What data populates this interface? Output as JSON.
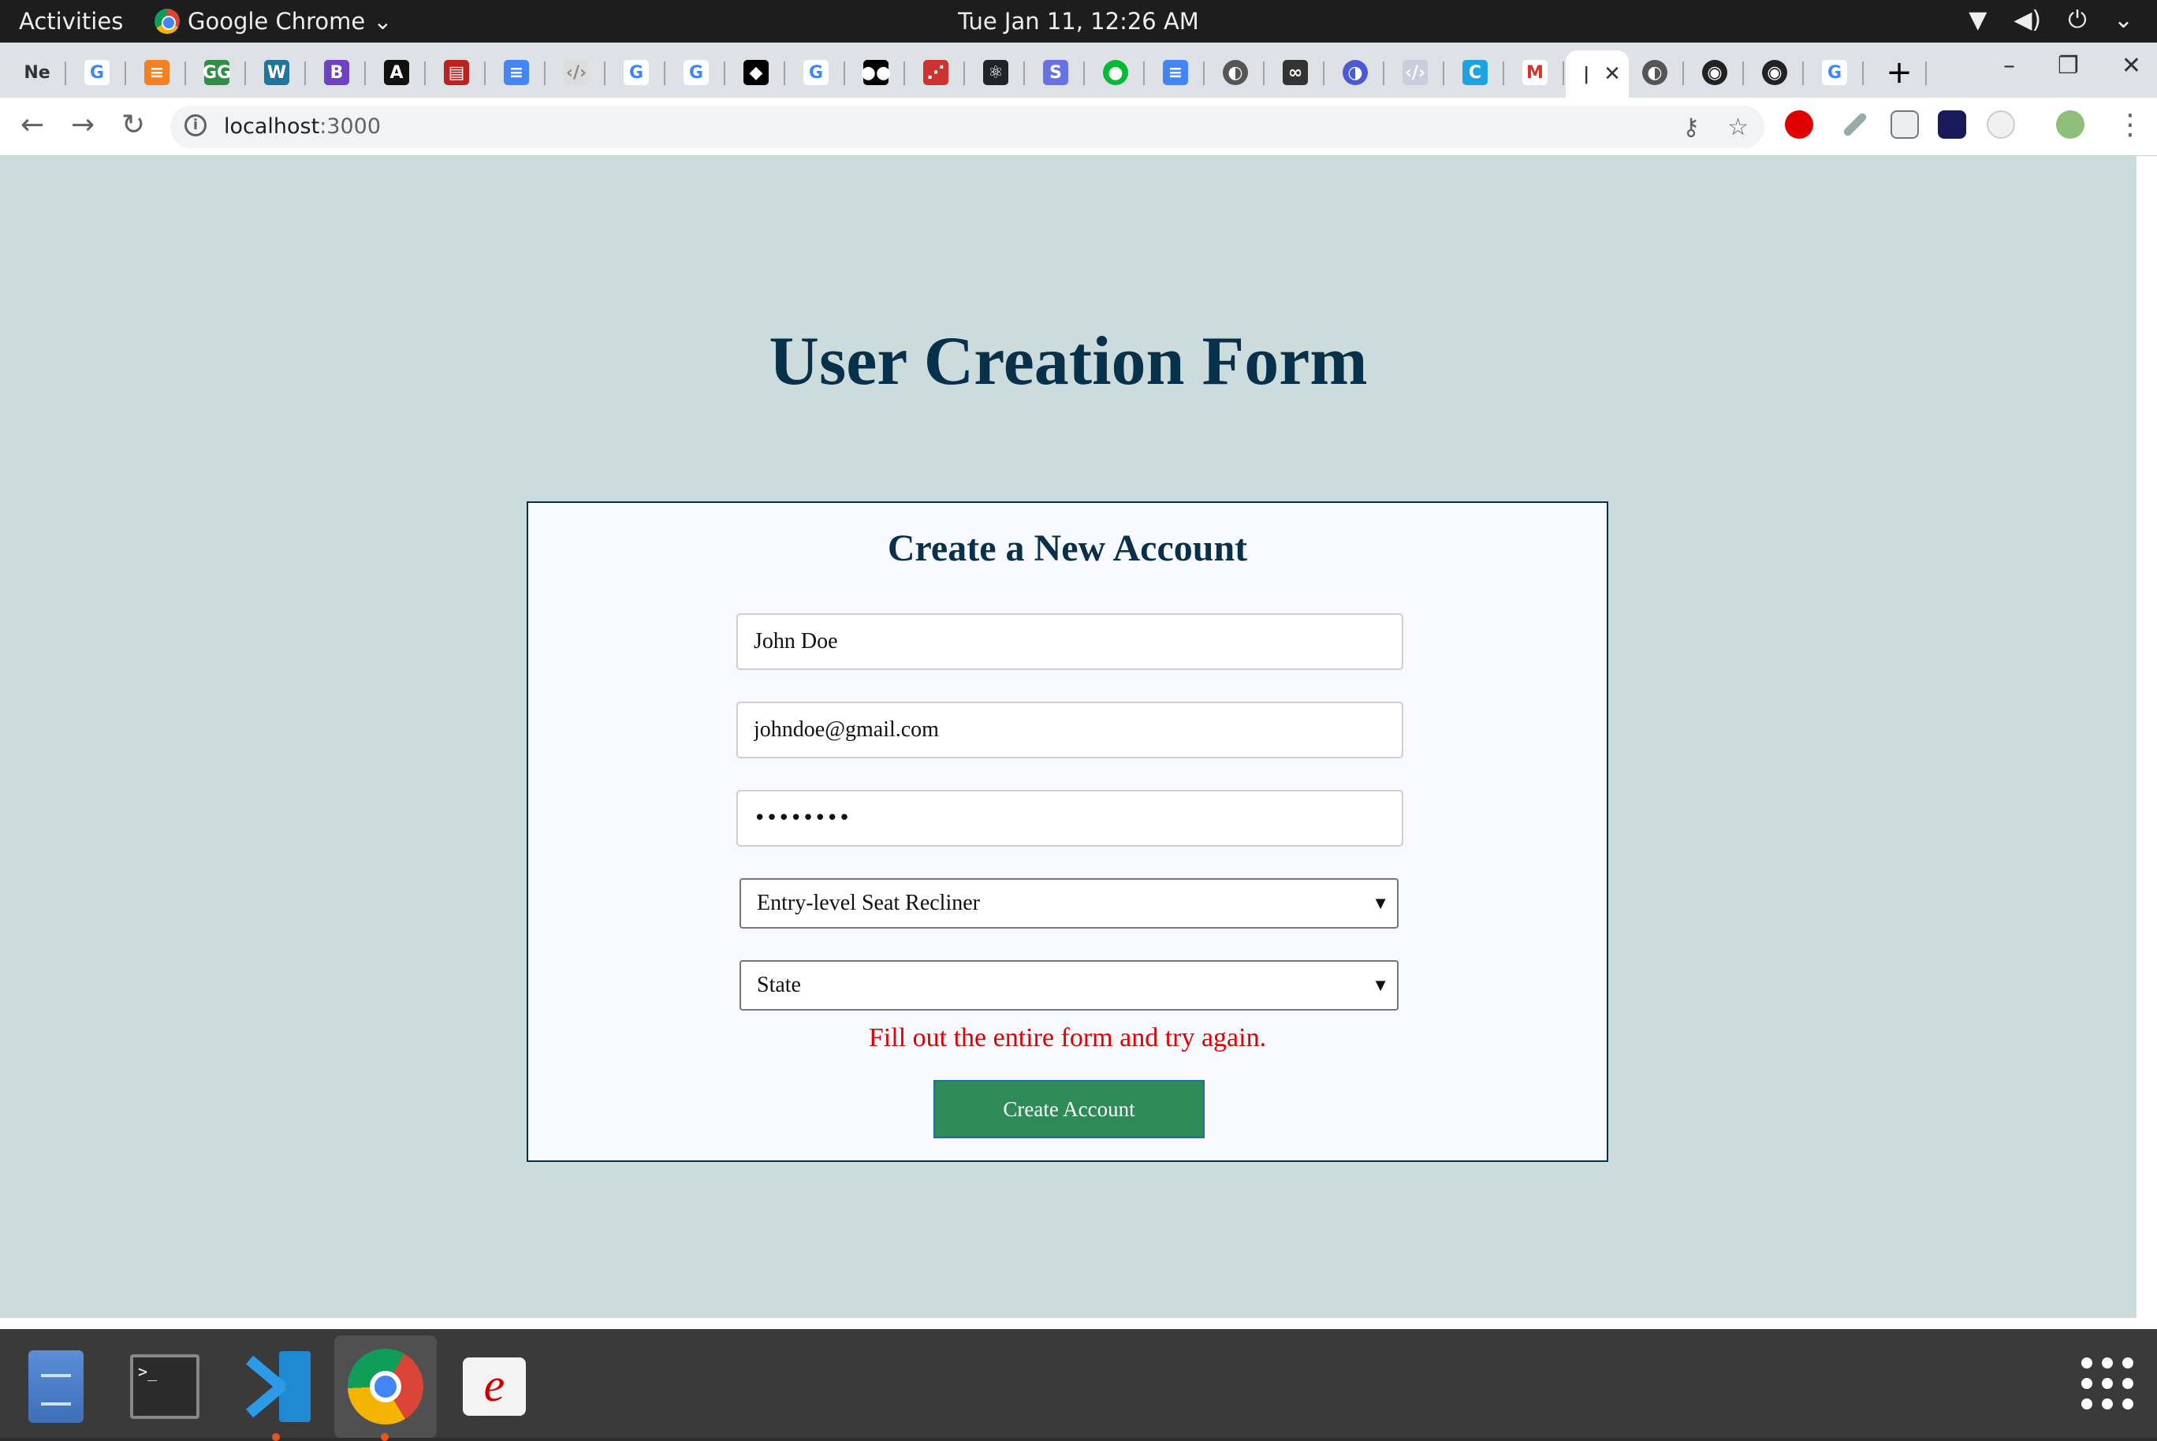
{
  "system": {
    "activities": "Activities",
    "app_name": "Google Chrome",
    "clock": "Tue Jan 11, 12:26 AM"
  },
  "tabs": [
    {
      "icon": "ne-text-icon",
      "label": "Ne"
    },
    {
      "icon": "google-icon",
      "label": "G"
    },
    {
      "icon": "stackoverflow-icon",
      "label": "≡"
    },
    {
      "icon": "geeksforgeeks-icon",
      "label": "GG"
    },
    {
      "icon": "wordpress-icon",
      "label": "W"
    },
    {
      "icon": "bootstrap-icon",
      "label": "B"
    },
    {
      "icon": "dark-app-icon",
      "label": "A"
    },
    {
      "icon": "red-box-icon",
      "label": "▤"
    },
    {
      "icon": "google-docs-icon",
      "label": "≡"
    },
    {
      "icon": "code-icon",
      "label": "‹/›"
    },
    {
      "icon": "google-icon",
      "label": "G"
    },
    {
      "icon": "google-icon",
      "label": "G"
    },
    {
      "icon": "black-app-icon",
      "label": "◆"
    },
    {
      "icon": "google-icon",
      "label": "G"
    },
    {
      "icon": "medium-icon",
      "label": "●●"
    },
    {
      "icon": "dots-icon",
      "label": "⋰"
    },
    {
      "icon": "react-icon",
      "label": "⚛"
    },
    {
      "icon": "stripe-icon",
      "label": "S"
    },
    {
      "icon": "mongodb-icon",
      "label": "●"
    },
    {
      "icon": "google-docs-icon",
      "label": "≡"
    },
    {
      "icon": "globe-icon",
      "label": "◐"
    },
    {
      "icon": "infinity-icon",
      "label": "∞"
    },
    {
      "icon": "linear-icon",
      "label": "◑"
    },
    {
      "icon": "codepen-icon",
      "label": "‹/›"
    },
    {
      "icon": "codecov-icon",
      "label": "C"
    },
    {
      "icon": "gmail-icon",
      "label": "M"
    },
    {
      "icon": "active-tab-icon",
      "label": "|"
    },
    {
      "icon": "globe-icon",
      "label": "◐"
    },
    {
      "icon": "github-icon",
      "label": "◉"
    },
    {
      "icon": "github-icon",
      "label": "◉"
    },
    {
      "icon": "google-icon",
      "label": "G"
    }
  ],
  "toolbar": {
    "url_host": "localhost",
    "url_port": ":3000"
  },
  "page": {
    "title": "User Creation Form",
    "card_title": "Create a New Account",
    "name_value": "John Doe",
    "email_value": "johndoe@gmail.com",
    "password_value": "••••••••",
    "occupation_value": "Entry-level Seat Recliner",
    "state_value": "State",
    "error_message": "Fill out the entire form and try again.",
    "submit_label": "Create Account"
  },
  "dock": [
    {
      "name": "files",
      "icon": "files-icon",
      "running": false
    },
    {
      "name": "terminal",
      "icon": "terminal-icon",
      "running": false
    },
    {
      "name": "vscode",
      "icon": "vscode-icon",
      "running": true
    },
    {
      "name": "chrome",
      "icon": "chrome-icon",
      "running": true
    },
    {
      "name": "editor",
      "icon": "editor-icon",
      "running": false
    }
  ],
  "colors": {
    "page_bg": "#ccdcdc",
    "heading": "#07304a",
    "card_bg": "#f8f8ff",
    "error": "#e00000",
    "button_bg": "#2e8b57"
  }
}
